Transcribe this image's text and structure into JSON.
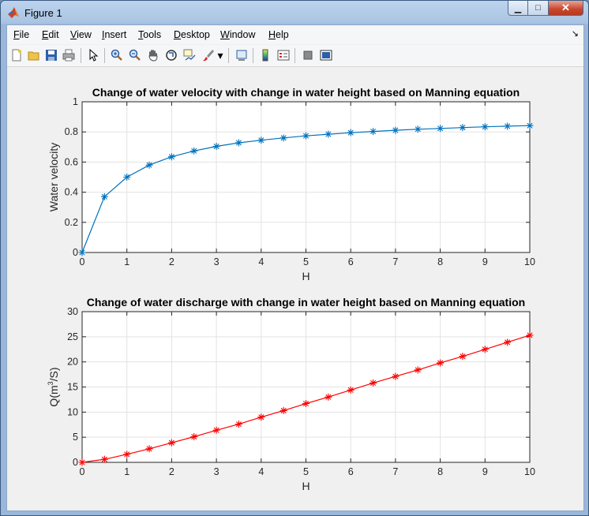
{
  "window": {
    "title": "Figure 1",
    "minimize_glyph": "▁",
    "maximize_glyph": "□",
    "close_glyph": "✕"
  },
  "menu": {
    "items": [
      "File",
      "Edit",
      "View",
      "Insert",
      "Tools",
      "Desktop",
      "Window",
      "Help"
    ],
    "overflow_glyph": "↘"
  },
  "toolbar": {
    "icons": [
      "new-figure-icon",
      "open-file-icon",
      "save-icon",
      "print-icon",
      "pointer-icon",
      "zoom-in-icon",
      "zoom-out-icon",
      "pan-icon",
      "rotate-3d-icon",
      "data-cursor-icon",
      "brush-icon",
      "brush-dropdown-icon",
      "link-plot-icon",
      "insert-colorbar-icon",
      "insert-legend-icon",
      "hide-plot-tools-icon",
      "show-plot-tools-icon"
    ],
    "dropdown_glyph": "▾"
  },
  "chart_data": [
    {
      "type": "line",
      "title": "Change of water velocity with change in water height based on Manning equation",
      "xlabel": "H",
      "ylabel": "Water velocity",
      "xlim": [
        0,
        10
      ],
      "ylim": [
        0,
        1
      ],
      "xticks": [
        "0",
        "1",
        "2",
        "3",
        "4",
        "5",
        "6",
        "7",
        "8",
        "9",
        "10"
      ],
      "yticks": [
        "0",
        "0.2",
        "0.4",
        "0.6",
        "0.8",
        "1"
      ],
      "grid": true,
      "marker": "*",
      "color": "#0072bd",
      "x": [
        0,
        0.5,
        1,
        1.5,
        2,
        2.5,
        3,
        3.5,
        4,
        4.5,
        5,
        5.5,
        6,
        6.5,
        7,
        7.5,
        8,
        8.5,
        9,
        9.5,
        10
      ],
      "y": [
        0,
        0.37,
        0.5,
        0.58,
        0.635,
        0.674,
        0.704,
        0.728,
        0.745,
        0.76,
        0.774,
        0.785,
        0.795,
        0.803,
        0.811,
        0.818,
        0.823,
        0.829,
        0.834,
        0.838,
        0.842
      ]
    },
    {
      "type": "line",
      "title": "Change of water discharge with change in water height based on Manning equation",
      "xlabel": "H",
      "ylabel": "Q(m",
      "ylabel_sup": "3",
      "ylabel_tail": "/S)",
      "xlim": [
        0,
        10
      ],
      "ylim": [
        0,
        30
      ],
      "xticks": [
        "0",
        "1",
        "2",
        "3",
        "4",
        "5",
        "6",
        "7",
        "8",
        "9",
        "10"
      ],
      "yticks": [
        "0",
        "5",
        "10",
        "15",
        "20",
        "25",
        "30"
      ],
      "grid": true,
      "marker": "*",
      "color": "#ff0000",
      "x": [
        0,
        0.5,
        1,
        1.5,
        2,
        2.5,
        3,
        3.5,
        4,
        4.5,
        5,
        5.5,
        6,
        6.5,
        7,
        7.5,
        8,
        8.5,
        9,
        9.5,
        10
      ],
      "y": [
        0,
        0.6,
        1.6,
        2.7,
        3.9,
        5.1,
        6.4,
        7.6,
        9.0,
        10.3,
        11.7,
        13.0,
        14.4,
        15.8,
        17.1,
        18.4,
        19.8,
        21.1,
        22.5,
        23.9,
        25.3
      ]
    }
  ]
}
